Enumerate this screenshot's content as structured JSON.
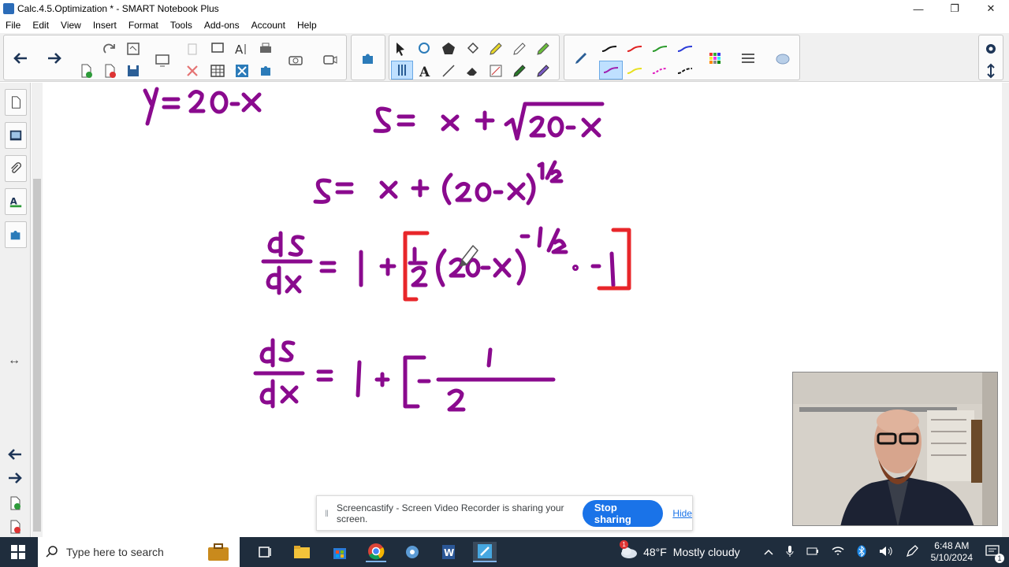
{
  "window": {
    "title": "Calc.4.5.Optimization * - SMART Notebook Plus",
    "controls": [
      "—",
      "❐",
      "✕"
    ]
  },
  "menu": [
    "File",
    "Edit",
    "View",
    "Insert",
    "Format",
    "Tools",
    "Add-ons",
    "Account",
    "Help"
  ],
  "colors": {
    "ink_purple": "#8a0a8e",
    "ink_red": "#e8262a",
    "accent_blue": "#1a73e8",
    "taskbar": "#1f2d3d"
  },
  "share_bar": {
    "message": "Screencastify - Screen Video Recorder is sharing your screen.",
    "stop_label": "Stop sharing",
    "hide_label": "Hide"
  },
  "taskbar": {
    "search_placeholder": "Type here to search",
    "weather_temp": "48°F",
    "weather_desc": "Mostly cloudy",
    "time": "6:48 AM",
    "date": "5/10/2024",
    "notification_count": "1",
    "weather_badge": "1"
  },
  "icons": {
    "toolbar": [
      "back-arrow-icon",
      "forward-arrow-icon",
      "undo-icon",
      "redo-icon",
      "new-page-icon",
      "delete-page-icon",
      "save-icon",
      "screen-shade-icon",
      "paste-icon",
      "delete-icon",
      "table-icon",
      "full-screen-icon",
      "text-recognition-icon",
      "print-icon",
      "camera-icon",
      "record-icon",
      "addons-icon",
      "select-icon",
      "pen-icon",
      "text-icon",
      "line-icon",
      "eraser-icon",
      "fill-icon",
      "highlighter-icon",
      "settings-icon"
    ],
    "sidebar": [
      "page-sorter-icon",
      "gallery-icon",
      "attachments-icon",
      "properties-icon",
      "addons-icon"
    ]
  }
}
